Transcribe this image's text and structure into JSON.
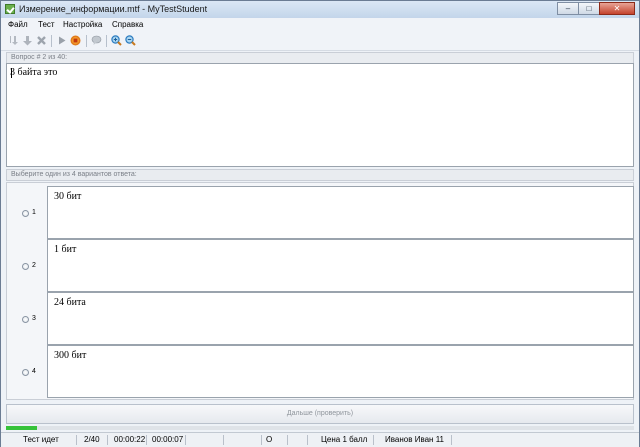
{
  "window": {
    "title": "Измерение_информации.mtf - MyTestStudent"
  },
  "menu": {
    "items": [
      "Файл",
      "Тест",
      "Настройка",
      "Справка"
    ]
  },
  "toolbar": {
    "icons": [
      "arrow-down-small-icon",
      "arrow-down-icon",
      "delete-icon",
      "play-icon",
      "stop-icon",
      "chat-icon",
      "zoom-in-icon",
      "zoom-out-icon"
    ]
  },
  "question": {
    "header": "Вопрос # 2 из 40:",
    "text": "3 байта это"
  },
  "answers": {
    "header": "Выберите один из 4 вариантов ответа:",
    "options": [
      {
        "num": "1",
        "text": "30 бит"
      },
      {
        "num": "2",
        "text": "1 бит"
      },
      {
        "num": "3",
        "text": "24 бита"
      },
      {
        "num": "4",
        "text": "300 бит"
      }
    ]
  },
  "next_button": "Дальше (проверить)",
  "progress": {
    "fraction": 0.05,
    "color": "#36c23a"
  },
  "status": {
    "state": "Тест идет",
    "count": "2/40",
    "time_total": "00:00:22",
    "time_question": "00:00:07",
    "mark": "О",
    "price": "Цена 1 балл",
    "student": "Иванов Иван 11"
  }
}
